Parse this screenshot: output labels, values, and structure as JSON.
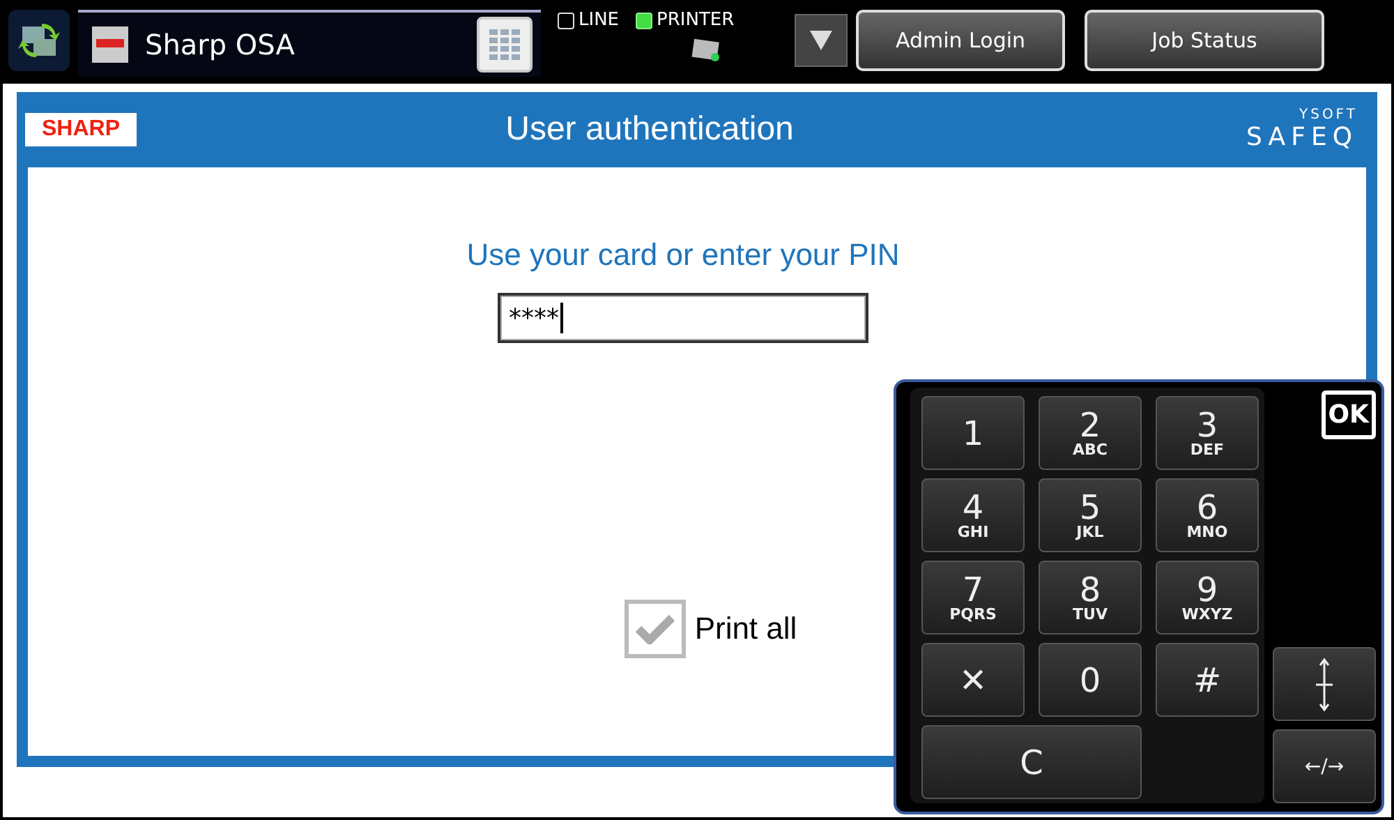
{
  "top_bar": {
    "app_title": "Sharp OSA",
    "indicators": [
      {
        "label": "LINE",
        "on": false
      },
      {
        "label": "PRINTER",
        "on": true
      }
    ],
    "buttons": [
      "Admin Login",
      "Job Status"
    ]
  },
  "header": {
    "brand": "SHARP",
    "title": "User authentication",
    "vendor_small": "YSOFT",
    "vendor_large": "SAFEQ"
  },
  "prompt": "Use your card or enter your PIN",
  "pin_field": {
    "value": "****"
  },
  "print_all": {
    "label": "Print all",
    "checked": true,
    "disabled": true
  },
  "keypad": {
    "ok": "OK",
    "keys": [
      {
        "kind": "digit",
        "label": "1"
      },
      {
        "kind": "digit",
        "label": "2",
        "sub": "ABC"
      },
      {
        "kind": "digit",
        "label": "3",
        "sub": "DEF"
      },
      {
        "kind": "digit",
        "label": "4",
        "sub": "GHI"
      },
      {
        "kind": "digit",
        "label": "5",
        "sub": "JKL"
      },
      {
        "kind": "digit",
        "label": "6",
        "sub": "MNO"
      },
      {
        "kind": "digit",
        "label": "7",
        "sub": "PQRS"
      },
      {
        "kind": "digit",
        "label": "8",
        "sub": "TUV"
      },
      {
        "kind": "digit",
        "label": "9",
        "sub": "WXYZ"
      },
      {
        "kind": "digit",
        "label": "✕"
      },
      {
        "kind": "digit",
        "label": "0"
      },
      {
        "kind": "digit",
        "label": "#"
      },
      {
        "kind": "wide",
        "label": "C"
      }
    ],
    "side_keys": [
      {
        "kind": "vertical"
      },
      {
        "kind": "text",
        "label": "←/→"
      }
    ]
  }
}
